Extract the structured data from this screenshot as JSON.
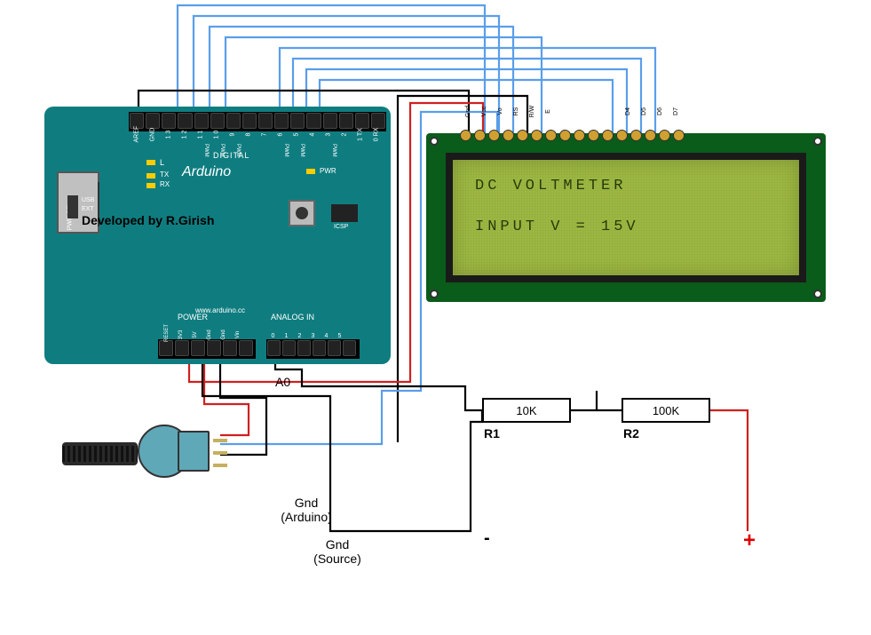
{
  "arduino": {
    "name": "Arduino",
    "url": "www.arduino.cc",
    "developed_by": "Developed by R.Girish",
    "labels": {
      "digital": "DIGITAL",
      "power": "POWER",
      "analog_in": "ANALOG IN",
      "icsp": "ICSP",
      "l": "L",
      "tx": "TX",
      "rx": "RX",
      "pwr": "PWR",
      "pwrsel": "PWR SEL",
      "usb": "USB",
      "ext": "EXT"
    },
    "digital_pins": [
      "AREF",
      "GND",
      "1 3",
      "1 2",
      "1 1",
      "1 0",
      "9",
      "8",
      "7",
      "6",
      "5",
      "4",
      "3",
      "2",
      "1 TX",
      "0 RX"
    ],
    "pwm_pins": [
      "",
      "",
      "",
      "",
      "PWM",
      "PWM",
      "PWM",
      "",
      "",
      "PWM",
      "PWM",
      "",
      "PWM",
      "",
      "",
      ""
    ],
    "power_pins": [
      "RESET",
      "3V3",
      "5V",
      "Gnd",
      "Gnd",
      "Vin"
    ],
    "analog_pins": [
      "0",
      "1",
      "2",
      "3",
      "4",
      "5"
    ]
  },
  "lcd": {
    "line1": "DC VOLTMETER",
    "line2": "INPUT V  = 15V",
    "pins": [
      "Gnd",
      "Vcc",
      "Vo",
      "RS",
      "R/W",
      "E",
      "",
      "",
      "",
      "",
      "D4",
      "D5",
      "D6",
      "D7",
      "",
      ""
    ]
  },
  "resistors": {
    "r1": {
      "value": "10K",
      "label": "R1"
    },
    "r2": {
      "value": "100K",
      "label": "R2"
    }
  },
  "annotations": {
    "a0": "A0",
    "gnd_arduino": "Gnd (Arduino)",
    "gnd_source": "Gnd (Source)",
    "minus": "-",
    "plus": "+"
  },
  "wires": {
    "blue": "#5a9eea",
    "black": "#000000",
    "red": "#d02020"
  }
}
